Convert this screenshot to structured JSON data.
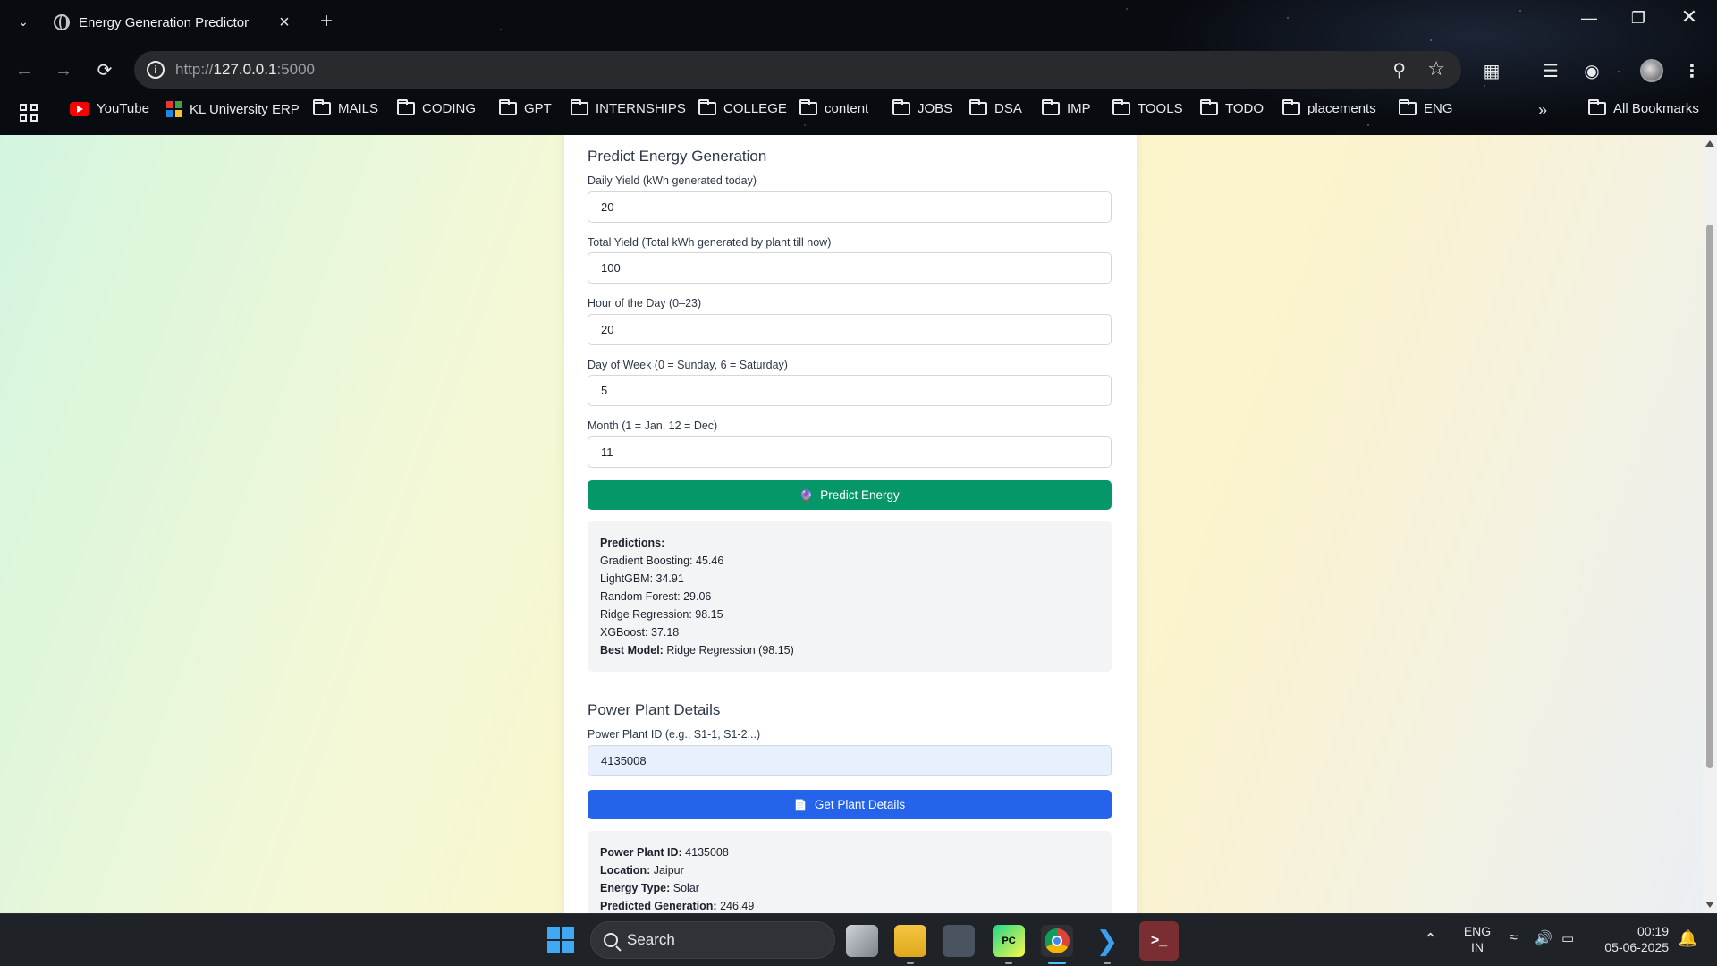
{
  "browser": {
    "tab_title": "Energy Generation Predictor",
    "url_scheme": "http://",
    "url_host": "127.0.0.1",
    "url_port": ":5000",
    "bookmarks": [
      {
        "label": "YouTube",
        "icon": "youtube-icon"
      },
      {
        "label": "KL University ERP",
        "icon": "kl-erp-icon"
      },
      {
        "label": "MAILS",
        "icon": "folder-icon"
      },
      {
        "label": "CODING",
        "icon": "folder-icon"
      },
      {
        "label": "GPT",
        "icon": "folder-icon"
      },
      {
        "label": "INTERNSHIPS",
        "icon": "folder-icon"
      },
      {
        "label": "COLLEGE",
        "icon": "folder-icon"
      },
      {
        "label": "content",
        "icon": "folder-icon"
      },
      {
        "label": "JOBS",
        "icon": "folder-icon"
      },
      {
        "label": "DSA",
        "icon": "folder-icon"
      },
      {
        "label": "IMP",
        "icon": "folder-icon"
      },
      {
        "label": "TOOLS",
        "icon": "folder-icon"
      },
      {
        "label": "TODO",
        "icon": "folder-icon"
      },
      {
        "label": "placements",
        "icon": "folder-icon"
      },
      {
        "label": "ENG",
        "icon": "folder-icon"
      }
    ],
    "more_bookmarks": "»",
    "all_bookmarks": "All Bookmarks"
  },
  "predict": {
    "title": "Predict Energy Generation",
    "fields": [
      {
        "label": "Daily Yield (kWh generated today)",
        "value": "20"
      },
      {
        "label": "Total Yield (Total kWh generated by plant till now)",
        "value": "100"
      },
      {
        "label": "Hour of the Day (0–23)",
        "value": "20"
      },
      {
        "label": "Day of Week (0 = Sunday, 6 = Saturday)",
        "value": "5"
      },
      {
        "label": "Month (1 = Jan, 12 = Dec)",
        "value": "11"
      }
    ],
    "button_label": "Predict Energy",
    "button_icon": "crystal-ball-icon",
    "results_heading": "Predictions:",
    "results": [
      "Gradient Boosting: 45.46",
      "LightGBM: 34.91",
      "Random Forest: 29.06",
      "Ridge Regression: 98.15",
      "XGBoost: 37.18"
    ],
    "best_model_label": "Best Model:",
    "best_model_value": "Ridge Regression (98.15)"
  },
  "plant": {
    "title": "Power Plant Details",
    "id_label": "Power Plant ID (e.g., S1-1, S1-2...)",
    "id_value": "4135008",
    "button_label": "Get Plant Details",
    "button_icon": "document-icon",
    "details": [
      {
        "label": "Power Plant ID:",
        "value": "4135008"
      },
      {
        "label": "Location:",
        "value": "Jaipur"
      },
      {
        "label": "Energy Type:",
        "value": "Solar"
      },
      {
        "label": "Predicted Generation:",
        "value": "246.49"
      }
    ]
  },
  "taskbar": {
    "search_label": "Search",
    "lang_top": "ENG",
    "lang_bottom": "IN",
    "time": "00:19",
    "date": "05-06-2025"
  },
  "colors": {
    "predict_button": "#059669",
    "plant_button": "#2563eb",
    "card_bg": "#ffffff"
  }
}
